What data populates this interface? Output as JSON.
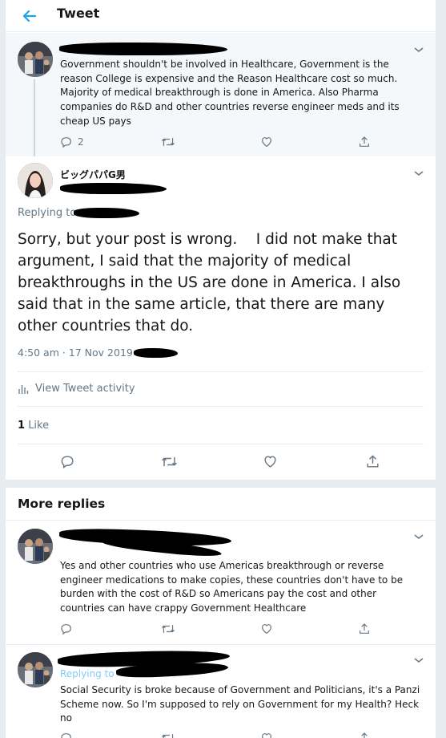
{
  "header": {
    "title": "Tweet"
  },
  "parent_tweet": {
    "text": "Government shouldn't be involved in Healthcare, Government is the reason College is expensive and the Reason Healthcare cost so much. Majority of medical breakthrough is done in America. Also Pharma companies do R&D and other countries reverse engineer meds and its cheap US pays",
    "reply_count": "2"
  },
  "main_tweet": {
    "display_name": "ビッグパパG男",
    "replying_to": "Replying to",
    "text": "Sorry, but your post is wrong.    I did not make that argument, I said that the majority of medical breakthroughs in the US are done in America. I also said that in the same article, that there are many other countries that do.",
    "timestamp": "4:50 am · 17 Nov 2019 ·",
    "activity_label": "View Tweet activity",
    "like_count": "1",
    "like_label": "Like"
  },
  "more_replies": {
    "heading": "More replies",
    "items": [
      {
        "text": "Yes and other countries who use Americas breakthrough or reverse engineer medications to make copies, these countries don't have to be burden with the cost of R&D so Americans pay the cost and other countries can have crappy Government Healthcare"
      },
      {
        "replying_to": "Replying to",
        "text": "Social Security is broke because of Government and Politicians, it's a Panzi Scheme now. So I'm supposed to rely on Government for my Health? Heck no"
      }
    ]
  },
  "colors": {
    "accent": "#1da1f2",
    "secondary_text": "#657786",
    "divider": "#e6ecf0",
    "thread_bg": "#f5f8fa"
  },
  "icons": [
    "back-arrow-icon",
    "chevron-down-icon",
    "reply-icon",
    "retweet-icon",
    "like-icon",
    "share-icon",
    "activity-icon"
  ]
}
